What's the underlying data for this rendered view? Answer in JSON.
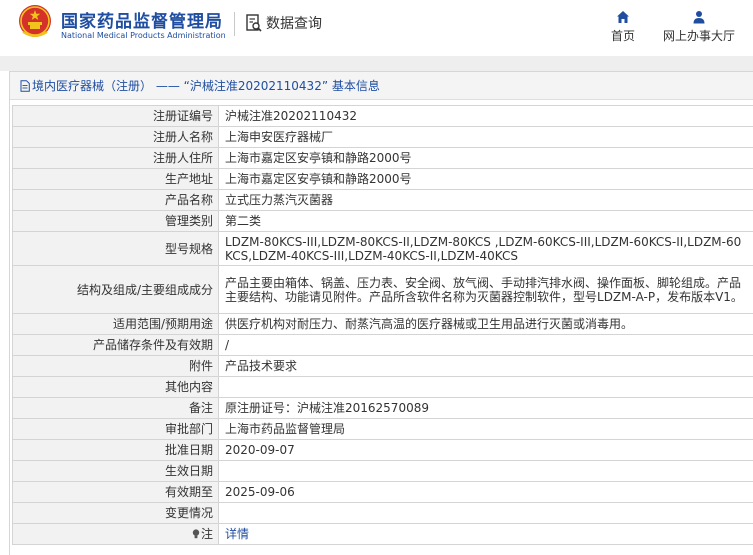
{
  "header": {
    "brand_cn": "国家药品监督管理局",
    "brand_en": "National Medical Products Administration",
    "query_label": "数据查询",
    "nav": {
      "home": "首页",
      "online_office": "网上办事大厅"
    }
  },
  "colors": {
    "brand": "#1f4ea1",
    "emblem_red": "#d4312b",
    "emblem_gold": "#f2c31c"
  },
  "icons": {
    "emblem": "national-emblem",
    "query": "search-document-icon",
    "home": "home-icon",
    "office": "user-icon",
    "title": "document-icon",
    "note": "lightbulb-icon"
  },
  "panel": {
    "title": "境内医疗器械（注册） —— “沪械注准20202110432” 基本信息"
  },
  "rows": [
    {
      "key": "注册证编号",
      "value": "沪械注准20202110432"
    },
    {
      "key": "注册人名称",
      "value": "上海申安医疗器械厂"
    },
    {
      "key": "注册人住所",
      "value": "上海市嘉定区安亭镇和静路2000号"
    },
    {
      "key": "生产地址",
      "value": "上海市嘉定区安亭镇和静路2000号"
    },
    {
      "key": "产品名称",
      "value": "立式压力蒸汽灭菌器"
    },
    {
      "key": "管理类别",
      "value": "第二类"
    },
    {
      "key": "型号规格",
      "value": "LDZM-80KCS-III,LDZM-80KCS-II,LDZM-80KCS ,LDZM-60KCS-III,LDZM-60KCS-II,LDZM-60KCS,LDZM-40KCS-III,LDZM-40KCS-II,LDZM-40KCS"
    },
    {
      "key": "结构及组成/主要组成成分",
      "value": "产品主要由箱体、锅盖、压力表、安全阀、放气阀、手动排汽排水阀、操作面板、脚轮组成。产品主要结构、功能请见附件。产品所含软件名称为灭菌器控制软件，型号LDZM-A-P，发布版本V1。"
    },
    {
      "key": "适用范围/预期用途",
      "value": "供医疗机构对耐压力、耐蒸汽高温的医疗器械或卫生用品进行灭菌或消毒用。"
    },
    {
      "key": "产品储存条件及有效期",
      "value": "/"
    },
    {
      "key": "附件",
      "value": "产品技术要求"
    },
    {
      "key": "其他内容",
      "value": ""
    },
    {
      "key": "备注",
      "value": "原注册证号：沪械注准20162570089"
    },
    {
      "key": "审批部门",
      "value": "上海市药品监督管理局"
    },
    {
      "key": "批准日期",
      "value": "2020-09-07"
    },
    {
      "key": "生效日期",
      "value": ""
    },
    {
      "key": "有效期至",
      "value": "2025-09-06"
    },
    {
      "key": "变更情况",
      "value": ""
    },
    {
      "key": "注",
      "value": "详情"
    }
  ]
}
